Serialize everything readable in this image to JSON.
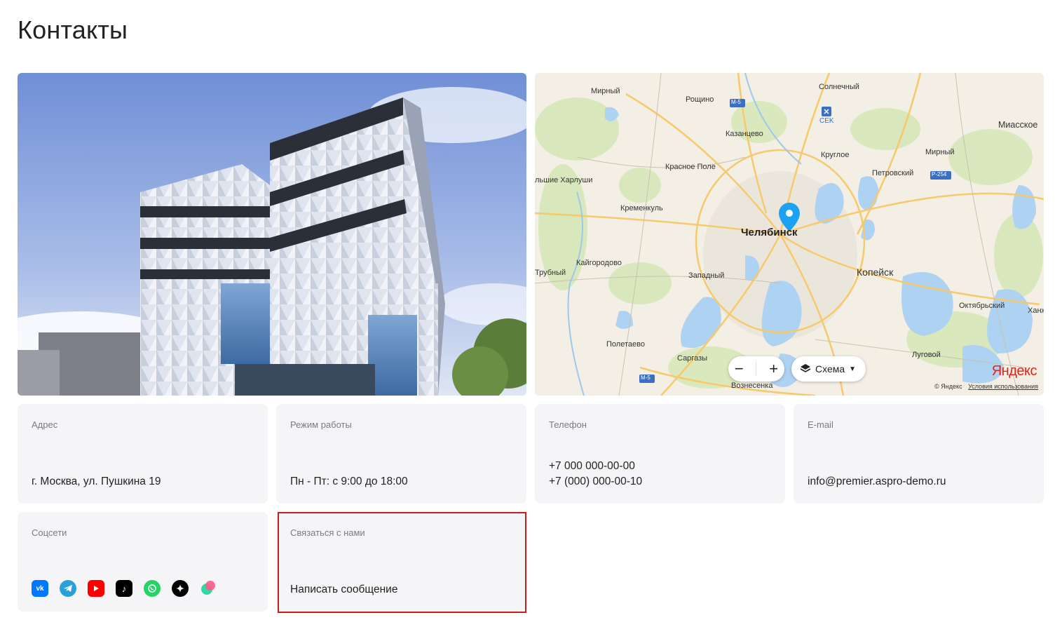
{
  "page": {
    "title": "Контакты"
  },
  "map": {
    "labels": {
      "mirny": "Мирный",
      "roshchino": "Рощино",
      "solnechny": "Солнечный",
      "m5_top": "M-5",
      "sek": "CEK",
      "miasskoe": "Миасское",
      "kazantsevo": "Казанцево",
      "mirny2": "Мирный",
      "kruglo": "Круглое",
      "krasnoe_pole": "Красное Поле",
      "petrovsky": "Петровский",
      "r254": "Р-254",
      "kharlushi": "льшие Харлуши",
      "kremenkul": "Кременкуль",
      "chelyabinsk": "Челябинск",
      "kaygorodovo": "Кайгородово",
      "trubny": "Трубный",
      "zapadny": "Западный",
      "kopeysk": "Копейск",
      "oktyabrsky": "Октябрьский",
      "khan": "Ханж",
      "poletaevo": "Полетаево",
      "sargazy": "Саргазы",
      "lugovoy": "Луговой",
      "m5_bottom": "M-5",
      "voznesenka": "Вознесенка"
    },
    "zoom_out": "−",
    "zoom_in": "+",
    "layer_label": "Схема",
    "logo": "Яндекс",
    "copyright": "© Яндекс",
    "terms": "Условия использования"
  },
  "cards": {
    "address": {
      "label": "Адрес",
      "value": "г. Москва, ул. Пушкина 19"
    },
    "hours": {
      "label": "Режим работы",
      "value": "Пн - Пт: с 9:00 до 18:00"
    },
    "phone": {
      "label": "Телефон",
      "value1": "+7 000 000-00-00",
      "value2": "+7 (000) 000-00-10"
    },
    "email": {
      "label": "E-mail",
      "value": "info@premier.aspro-demo.ru"
    },
    "social": {
      "label": "Соцсети"
    },
    "contact": {
      "label": "Связаться с нами",
      "value": "Написать сообщение"
    }
  },
  "social_icons": [
    "vk-icon",
    "telegram-icon",
    "youtube-icon",
    "tiktok-icon",
    "whatsapp-icon",
    "zen-icon",
    "yandex-messenger-icon"
  ],
  "colors": {
    "vk": "#0077ff",
    "telegram": "#29a0da",
    "youtube": "#ff0000",
    "tiktok": "#000000",
    "whatsapp": "#25d366",
    "zen": "#000000",
    "highlight": "#c81d1d",
    "map_pin": "#1da1f2"
  }
}
